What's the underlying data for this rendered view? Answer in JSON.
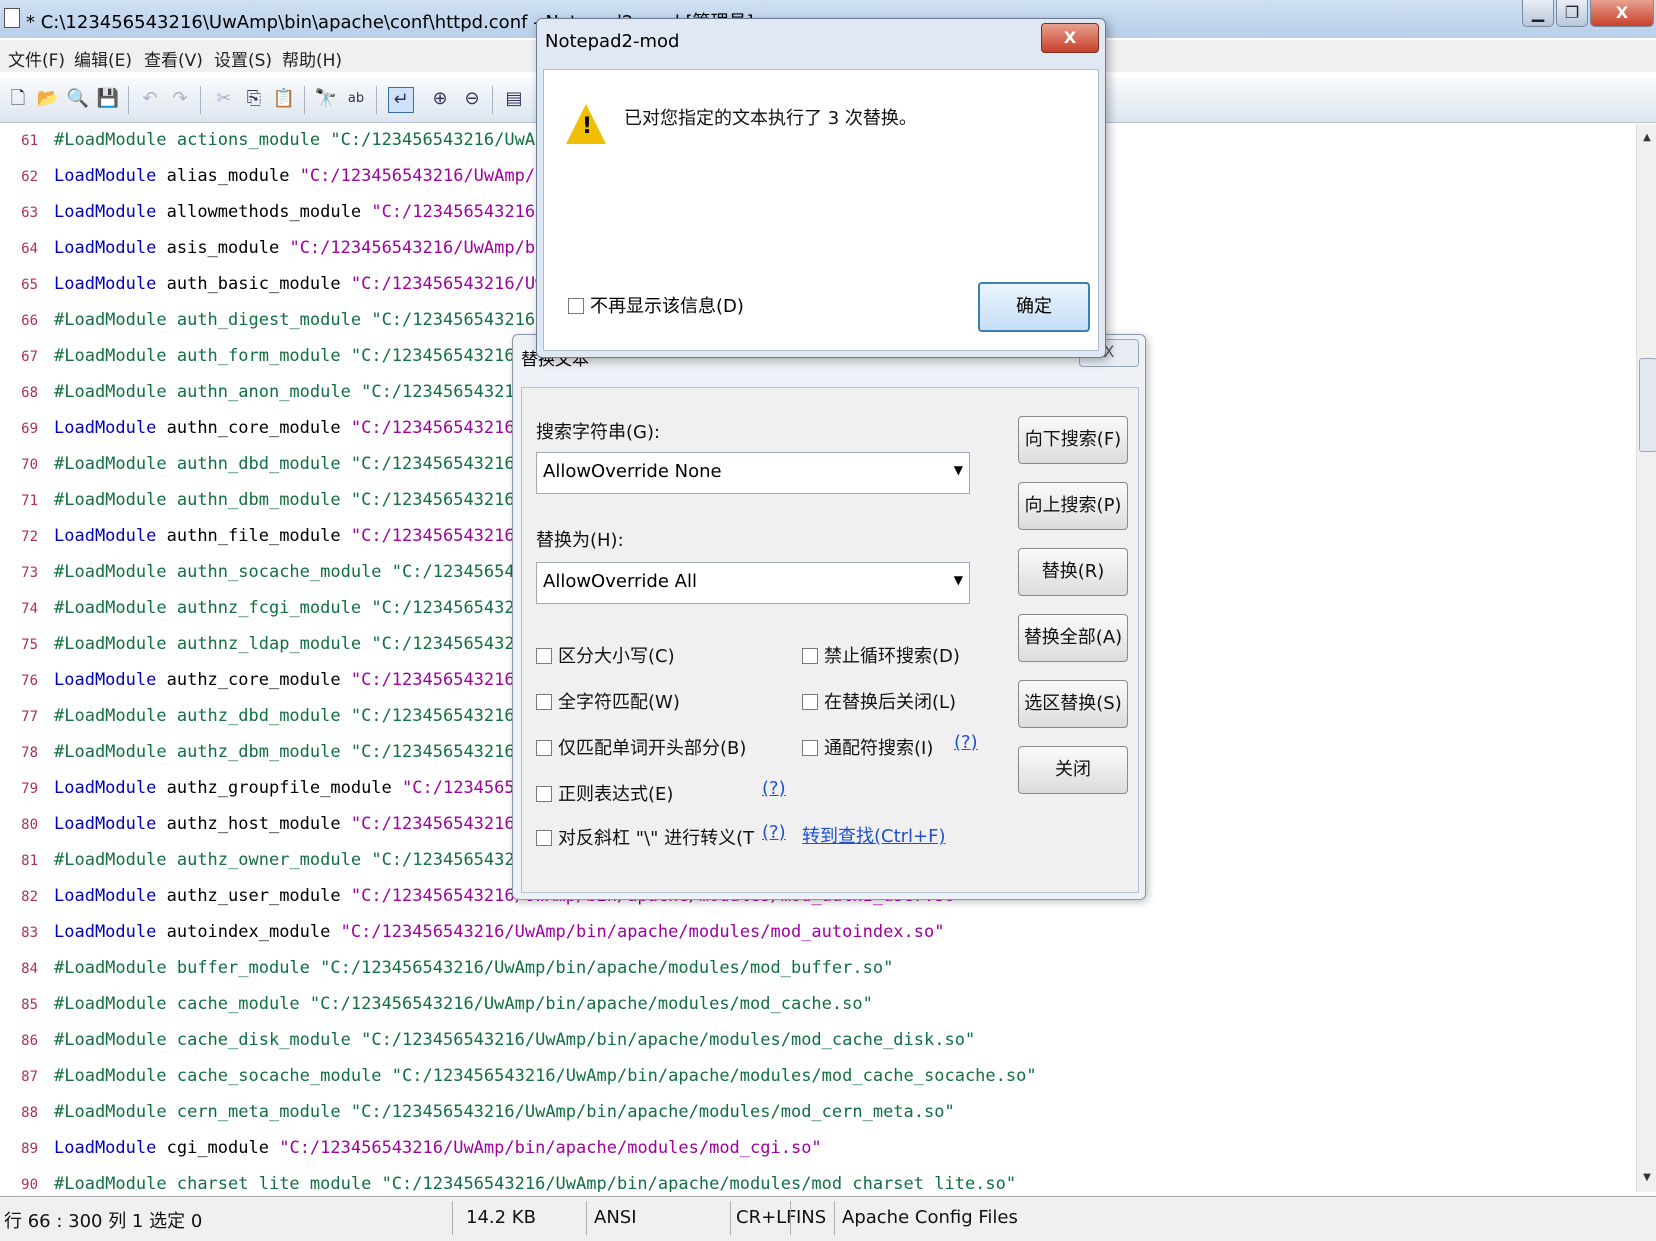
{
  "window": {
    "title": "* C:\\123456543216\\UwAmp\\bin\\apache\\conf\\httpd.conf - Notepad2-mod [管理员]",
    "min_glyph": "▁",
    "max_glyph": "❐",
    "close_glyph": "X"
  },
  "menu": {
    "items": [
      "文件(F)",
      "编辑(E)",
      "查看(V)",
      "设置(S)",
      "帮助(H)"
    ]
  },
  "toolbar": {
    "icons": [
      {
        "name": "new-file-icon",
        "glyph": "🗋"
      },
      {
        "name": "open-folder-icon",
        "glyph": "📂"
      },
      {
        "name": "browse-icon",
        "glyph": "🔍"
      },
      {
        "name": "save-icon",
        "glyph": "💾"
      },
      {
        "name": "undo-icon",
        "glyph": "↶"
      },
      {
        "name": "redo-icon",
        "glyph": "↷"
      },
      {
        "name": "cut-icon",
        "glyph": "✂"
      },
      {
        "name": "copy-icon",
        "glyph": "⎘"
      },
      {
        "name": "paste-icon",
        "glyph": "📋"
      },
      {
        "name": "find-icon",
        "glyph": "🔭"
      },
      {
        "name": "replace-icon",
        "glyph": "ab"
      },
      {
        "name": "word-wrap-icon",
        "glyph": "↵"
      },
      {
        "name": "zoom-in-icon",
        "glyph": "⊕"
      },
      {
        "name": "zoom-out-icon",
        "glyph": "⊖"
      },
      {
        "name": "scheme-icon",
        "glyph": "▤"
      }
    ]
  },
  "editor": {
    "lines": [
      {
        "n": "61",
        "comment": true,
        "kw": "#LoadModule",
        "name": "actions_module",
        "path": "\"C:/123456543216/UwAmp/bin/apache/modules/mod_actions.so\""
      },
      {
        "n": "62",
        "comment": false,
        "kw": "LoadModule",
        "name": "alias_module",
        "path": "\"C:/123456543216/UwAmp/bin/apache/modules/mod_alias.so\""
      },
      {
        "n": "63",
        "comment": false,
        "kw": "LoadModule",
        "name": "allowmethods_module",
        "path": "\"C:/123456543216/UwAmp/bin/apache/modules/mod_allowmethods.so\""
      },
      {
        "n": "64",
        "comment": false,
        "kw": "LoadModule",
        "name": "asis_module",
        "path": "\"C:/123456543216/UwAmp/bin/apache/modules/mod_asis.so\""
      },
      {
        "n": "65",
        "comment": false,
        "kw": "LoadModule",
        "name": "auth_basic_module",
        "path": "\"C:/123456543216/UwAmp/bin/apache/modules/mod_auth_basic.so\""
      },
      {
        "n": "66",
        "comment": true,
        "kw": "#LoadModule",
        "name": "auth_digest_module",
        "path": "\"C:/123456543216/UwAmp/bin/apache/modules/mod_auth_digest.so\""
      },
      {
        "n": "67",
        "comment": true,
        "kw": "#LoadModule",
        "name": "auth_form_module",
        "path": "\"C:/123456543216/UwAmp/bin/apache/modules/mod_auth_form.so\""
      },
      {
        "n": "68",
        "comment": true,
        "kw": "#LoadModule",
        "name": "authn_anon_module",
        "path": "\"C:/123456543216/UwAmp/bin/apache/modules/mod_authn_anon.so\""
      },
      {
        "n": "69",
        "comment": false,
        "kw": "LoadModule",
        "name": "authn_core_module",
        "path": "\"C:/123456543216/UwAmp/bin/apache/modules/mod_authn_core.so\""
      },
      {
        "n": "70",
        "comment": true,
        "kw": "#LoadModule",
        "name": "authn_dbd_module",
        "path": "\"C:/123456543216/UwAmp/bin/apache/modules/mod_authn_dbd.so\""
      },
      {
        "n": "71",
        "comment": true,
        "kw": "#LoadModule",
        "name": "authn_dbm_module",
        "path": "\"C:/123456543216/UwAmp/bin/apache/modules/mod_authn_dbm.so\""
      },
      {
        "n": "72",
        "comment": false,
        "kw": "LoadModule",
        "name": "authn_file_module",
        "path": "\"C:/123456543216/UwAmp/bin/apache/modules/mod_authn_file.so\""
      },
      {
        "n": "73",
        "comment": true,
        "kw": "#LoadModule",
        "name": "authn_socache_module",
        "path": "\"C:/123456543216/UwAmp/bin/apache/modules/mod_authn_socache.so\""
      },
      {
        "n": "74",
        "comment": true,
        "kw": "#LoadModule",
        "name": "authnz_fcgi_module",
        "path": "\"C:/123456543216/UwAmp/bin/apache/modules/mod_authnz_fcgi.so\""
      },
      {
        "n": "75",
        "comment": true,
        "kw": "#LoadModule",
        "name": "authnz_ldap_module",
        "path": "\"C:/123456543216/UwAmp/bin/apache/modules/mod_authnz_ldap.so\""
      },
      {
        "n": "76",
        "comment": false,
        "kw": "LoadModule",
        "name": "authz_core_module",
        "path": "\"C:/123456543216/UwAmp/bin/apache/modules/mod_authz_core.so\""
      },
      {
        "n": "77",
        "comment": true,
        "kw": "#LoadModule",
        "name": "authz_dbd_module",
        "path": "\"C:/123456543216/UwAmp/bin/apache/modules/mod_authz_dbd.so\""
      },
      {
        "n": "78",
        "comment": true,
        "kw": "#LoadModule",
        "name": "authz_dbm_module",
        "path": "\"C:/123456543216/UwAmp/bin/apache/modules/mod_authz_dbm.so\""
      },
      {
        "n": "79",
        "comment": false,
        "kw": "LoadModule",
        "name": "authz_groupfile_module",
        "path": "\"C:/123456543216/UwAmp/bin/apache/modules/mod_authz_groupfile.so\""
      },
      {
        "n": "80",
        "comment": false,
        "kw": "LoadModule",
        "name": "authz_host_module",
        "path": "\"C:/123456543216/UwAmp/bin/apache/modules/mod_authz_host.so\""
      },
      {
        "n": "81",
        "comment": true,
        "kw": "#LoadModule",
        "name": "authz_owner_module",
        "path": "\"C:/123456543216/UwAmp/bin/apache/modules/mod_authz_owner.so\""
      },
      {
        "n": "82",
        "comment": false,
        "kw": "LoadModule",
        "name": "authz_user_module",
        "path": "\"C:/123456543216/UwAmp/bin/apache/modules/mod_authz_user.so\""
      },
      {
        "n": "83",
        "comment": false,
        "kw": "LoadModule",
        "name": "autoindex_module",
        "path": "\"C:/123456543216/UwAmp/bin/apache/modules/mod_autoindex.so\""
      },
      {
        "n": "84",
        "comment": true,
        "kw": "#LoadModule",
        "name": "buffer_module",
        "path": "\"C:/123456543216/UwAmp/bin/apache/modules/mod_buffer.so\""
      },
      {
        "n": "85",
        "comment": true,
        "kw": "#LoadModule",
        "name": "cache_module",
        "path": "\"C:/123456543216/UwAmp/bin/apache/modules/mod_cache.so\""
      },
      {
        "n": "86",
        "comment": true,
        "kw": "#LoadModule",
        "name": "cache_disk_module",
        "path": "\"C:/123456543216/UwAmp/bin/apache/modules/mod_cache_disk.so\""
      },
      {
        "n": "87",
        "comment": true,
        "kw": "#LoadModule",
        "name": "cache_socache_module",
        "path": "\"C:/123456543216/UwAmp/bin/apache/modules/mod_cache_socache.so\""
      },
      {
        "n": "88",
        "comment": true,
        "kw": "#LoadModule",
        "name": "cern_meta_module",
        "path": "\"C:/123456543216/UwAmp/bin/apache/modules/mod_cern_meta.so\""
      },
      {
        "n": "89",
        "comment": false,
        "kw": "LoadModule",
        "name": "cgi_module",
        "path": "\"C:/123456543216/UwAmp/bin/apache/modules/mod_cgi.so\""
      },
      {
        "n": "90",
        "comment": true,
        "kw": "#LoadModule",
        "name": "charset_lite_module",
        "path": "\"C:/123456543216/UwAmp/bin/apache/modules/mod_charset_lite.so\""
      }
    ]
  },
  "statusbar": {
    "position": "行 66 : 300   列 1   选定 0",
    "size": "14.2 KB",
    "encoding": "ANSI",
    "eol": "CR+LF",
    "mode": "INS",
    "scheme": "Apache Config Files"
  },
  "replace_dialog": {
    "title": "替换文本",
    "close_glyph": "X",
    "search_label": "搜索字符串(G):",
    "search_value": "AllowOverride None",
    "replace_label": "替换为(H):",
    "replace_value": "AllowOverride All",
    "buttons": {
      "find_next": "向下搜索(F)",
      "find_prev": "向上搜索(P)",
      "replace": "替换(R)",
      "replace_all": "替换全部(A)",
      "replace_in_selection": "选区替换(S)",
      "close": "关闭"
    },
    "options": {
      "match_case": "区分大小写(C)",
      "no_wrap": "禁止循环搜索(D)",
      "whole_word": "全字符匹配(W)",
      "close_after": "在替换后关闭(L)",
      "word_start": "仅匹配单词开头部分(B)",
      "wildcard": "通配符搜索(I)",
      "regex": "正则表达式(E)",
      "backslash": "对反斜杠 \"\\\" 进行转义(T"
    },
    "help_text": "(?)",
    "goto_find": "转到查找(Ctrl+F)"
  },
  "message_box": {
    "title": "Notepad2-mod",
    "close_glyph": "X",
    "text": "已对您指定的文本执行了 3 次替换。",
    "dont_show": "不再显示该信息(D)",
    "ok": "确定"
  }
}
